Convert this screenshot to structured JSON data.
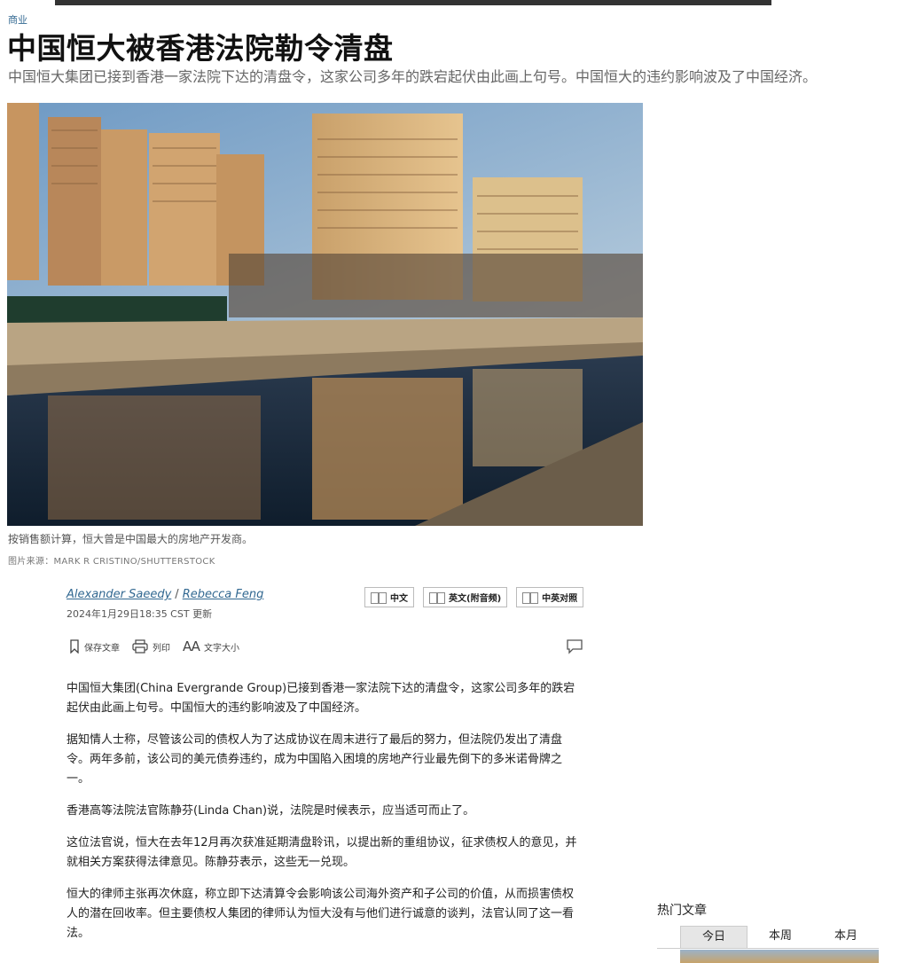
{
  "section": "商业",
  "headline": "中国恒大被香港法院勒令清盘",
  "summary": "中国恒大集团已接到香港一家法院下达的清盘令，这家公司多年的跌宕起伏由此画上句号。中国恒大的违约影响波及了中国经济。",
  "photo": {
    "caption": "按销售额计算，恒大曾是中国最大的房地产开发商。",
    "credit": "图片来源：MARK R CRISTINO/SHUTTERSTOCK"
  },
  "byline": {
    "author1": "Alexander Saeedy",
    "separator": "/",
    "author2": "Rebecca Feng",
    "date": "2024年1月29日18:35 CST 更新"
  },
  "language_buttons": {
    "chinese": "中文",
    "english": "英文(附音频)",
    "bilingual": "中英对照"
  },
  "tools": {
    "save": "保存文章",
    "print": "列印",
    "font_size_glyph": "AA",
    "font_size": "文字大小"
  },
  "article": {
    "paragraphs": [
      "中国恒大集团(China Evergrande Group)已接到香港一家法院下达的清盘令，这家公司多年的跌宕起伏由此画上句号。中国恒大的违约影响波及了中国经济。",
      "据知情人士称，尽管该公司的债权人为了达成协议在周末进行了最后的努力，但法院仍发出了清盘令。两年多前，该公司的美元债券违约，成为中国陷入困境的房地产行业最先倒下的多米诺骨牌之一。",
      "香港高等法院法官陈静芬(Linda Chan)说，法院是时候表示，应当适可而止了。",
      "这位法官说，恒大在去年12月再次获准延期清盘聆讯，以提出新的重组协议，征求债权人的意见，并就相关方案获得法律意见。陈静芬表示，这些无一兑现。",
      "恒大的律师主张再次休庭，称立即下达清算令会影响该公司海外资产和子公司的价值，从而损害债权人的潜在回收率。但主要债权人集团的律师认为恒大没有与他们进行诚意的谈判，法官认同了这一看法。"
    ]
  },
  "popular": {
    "title": "热门文章",
    "tabs": [
      "今日",
      "本周",
      "本月"
    ]
  }
}
